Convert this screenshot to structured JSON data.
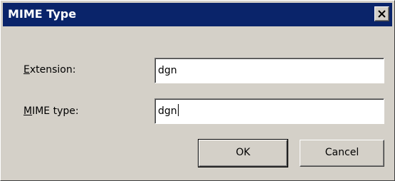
{
  "window": {
    "title": "MIME Type",
    "close_glyph": "✕"
  },
  "form": {
    "extension": {
      "label_mnemonic": "E",
      "label_rest": "xtension:",
      "value": "dgn"
    },
    "mime_type": {
      "label_mnemonic": "M",
      "label_rest": "IME type:",
      "value": "dgn"
    }
  },
  "buttons": {
    "ok_label": "OK",
    "cancel_label": "Cancel"
  },
  "colors": {
    "titlebar": "#0a246a",
    "face": "#d4d0c8"
  }
}
